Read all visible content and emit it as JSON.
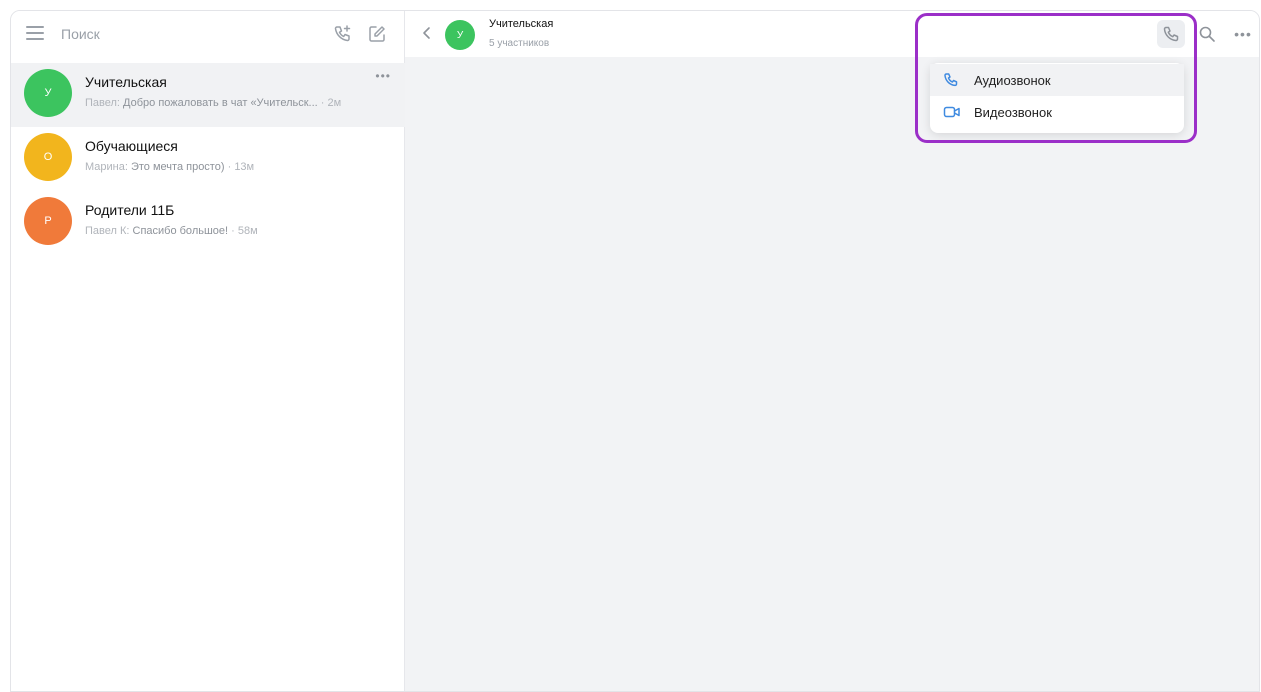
{
  "sidebar": {
    "search_placeholder": "Поиск",
    "chats": [
      {
        "name": "Учительская",
        "avatar_letter": "У",
        "avatar_color": "#3cc45f",
        "author": "Павел:",
        "snippet": "Добро пожаловать в чат «Учительск...",
        "time": "2м",
        "more": "•••"
      },
      {
        "name": "Обучающиеся",
        "avatar_letter": "О",
        "avatar_color": "#f2b51d",
        "author": "Марина:",
        "snippet": "Это мечта просто)",
        "time": "13м"
      },
      {
        "name": "Родители 11Б",
        "avatar_letter": "Р",
        "avatar_color": "#f07a3a",
        "author": "Павел К:",
        "snippet": "Спасибо большое!",
        "time": "58м"
      }
    ]
  },
  "header": {
    "title": "Учительская",
    "subtitle": "5 участников",
    "avatar_letter": "У",
    "more": "•••"
  },
  "call_menu": {
    "items": [
      {
        "label": "Аудиозвонок",
        "icon": "phone-icon"
      },
      {
        "label": "Видеозвонок",
        "icon": "video-icon"
      }
    ]
  },
  "colors": {
    "accent": "#3f8ae0",
    "highlight": "#9b2fc8"
  }
}
